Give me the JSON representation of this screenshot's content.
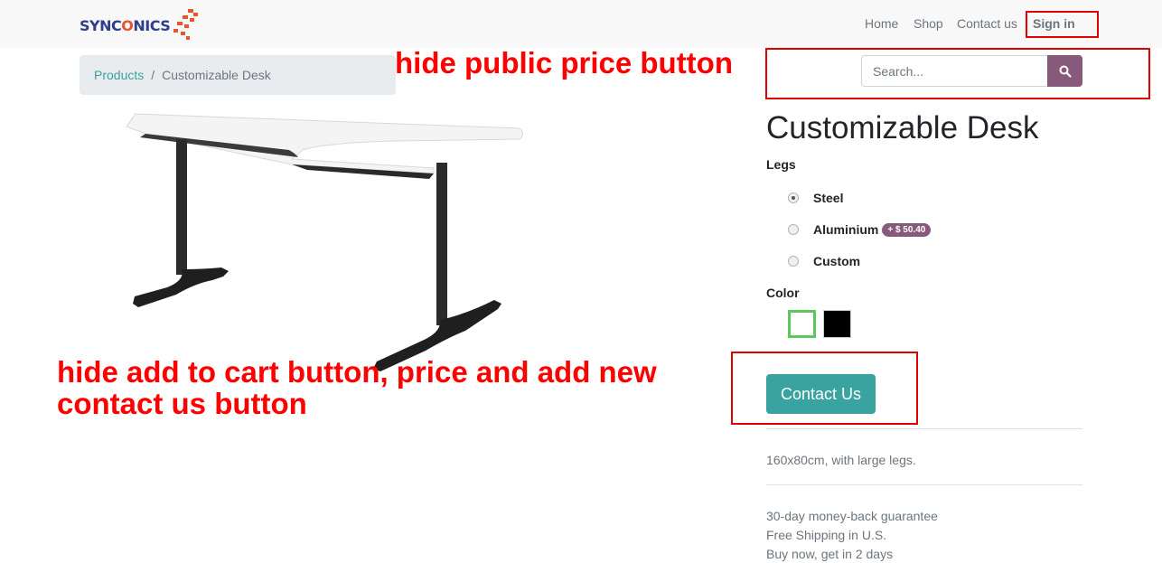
{
  "header": {
    "logo_text_a": "SYNC",
    "logo_text_o": "O",
    "logo_text_b": "NICS",
    "nav": [
      "Home",
      "Shop",
      "Contact us"
    ],
    "signin": "Sign in"
  },
  "breadcrumb": {
    "parent": "Products",
    "sep": "/",
    "current": "Customizable Desk"
  },
  "search": {
    "placeholder": "Search..."
  },
  "product": {
    "title": "Customizable Desk",
    "legs_label": "Legs",
    "legs_options": [
      {
        "label": "Steel",
        "selected": true
      },
      {
        "label": "Aluminium",
        "extra": "+ $ 50.40"
      },
      {
        "label": "Custom"
      }
    ],
    "color_label": "Color",
    "colors": [
      "#ffffff",
      "#000000"
    ],
    "selected_color": "#ffffff",
    "cta": "Contact Us",
    "description": "160x80cm, with large legs.",
    "perks": [
      "30-day money-back guarantee",
      "Free Shipping in U.S.",
      "Buy now, get in 2 days"
    ]
  },
  "annotations": {
    "price_note": "hide public price button",
    "cart_note_line1": "hide add to cart button, price and add new",
    "cart_note_line2": "contact us button"
  },
  "colors": {
    "accent": "#3aa29f",
    "brand": "#875a7b",
    "annotation": "#ff0000"
  }
}
